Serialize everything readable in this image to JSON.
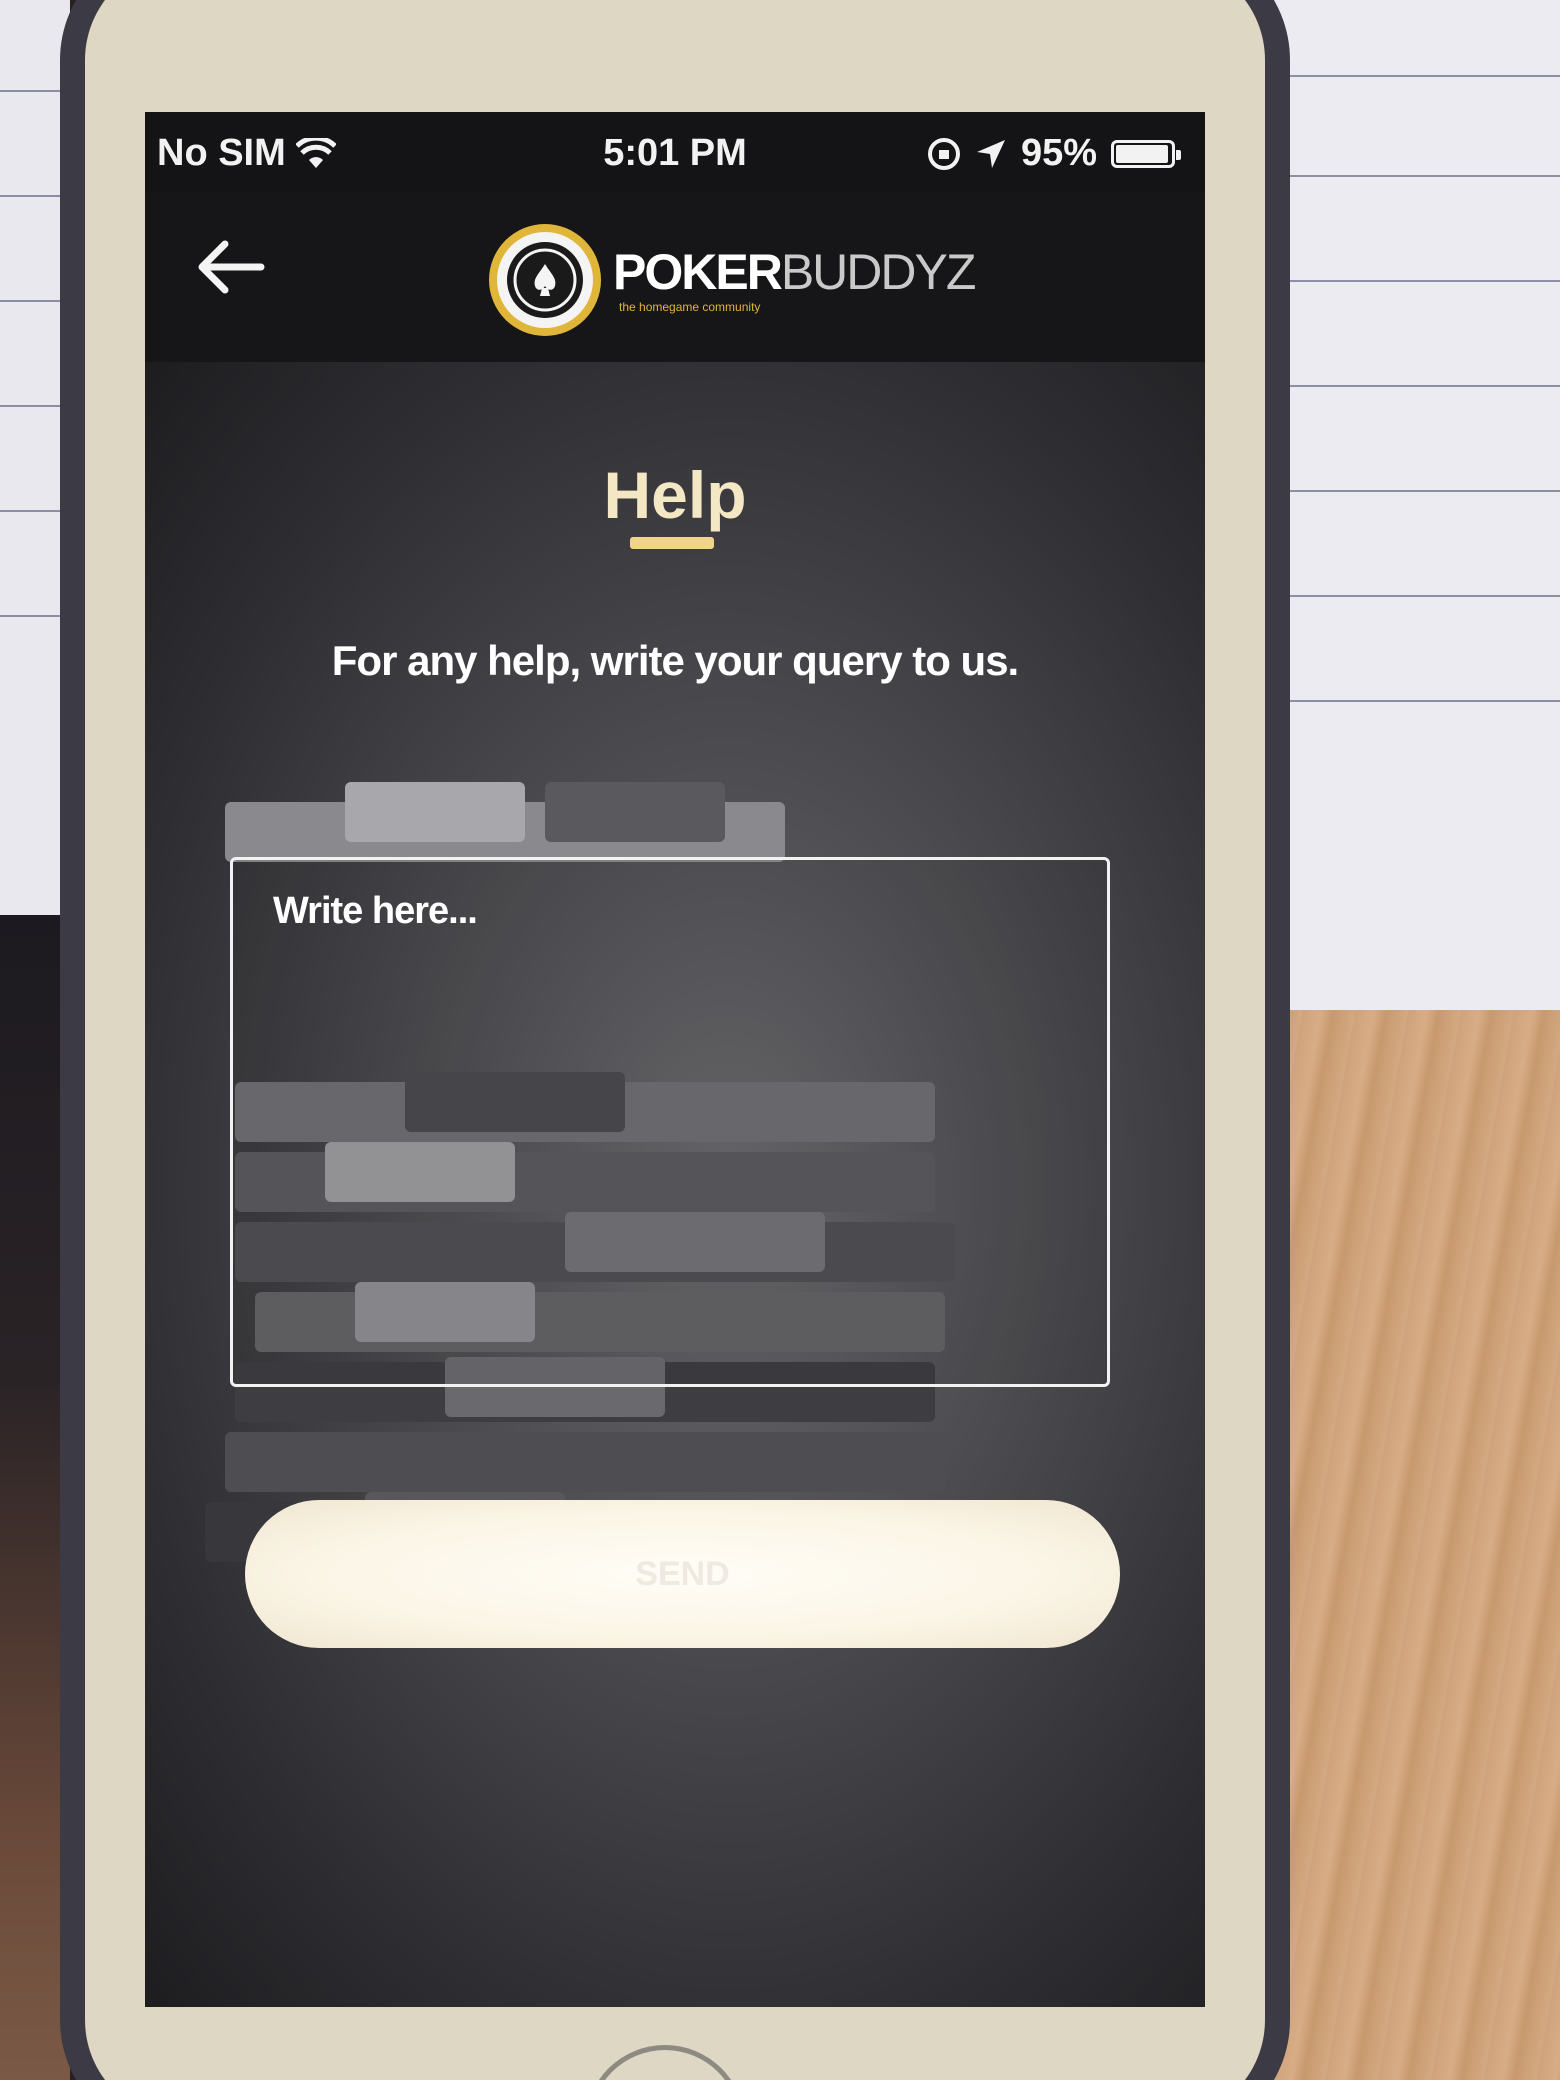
{
  "status_bar": {
    "carrier": "No SIM",
    "time": "5:01 PM",
    "battery": "95%",
    "icons": [
      "wifi-icon",
      "rotation-lock-icon",
      "location-icon",
      "battery-icon"
    ]
  },
  "header": {
    "back_icon": "arrow-left-icon",
    "logo_brand_part1": "POKER",
    "logo_brand_part2": "BUDDYZ",
    "logo_tagline": "the homegame community"
  },
  "page": {
    "title": "Help",
    "subtitle": "For any help, write your query to us.",
    "query_placeholder": "Write here...",
    "submit_label": "SEND"
  },
  "colors": {
    "title": "#f3e7c4",
    "accent": "#f0d48a",
    "logo_gold": "#e0b63a",
    "header_bg": "#161618"
  }
}
